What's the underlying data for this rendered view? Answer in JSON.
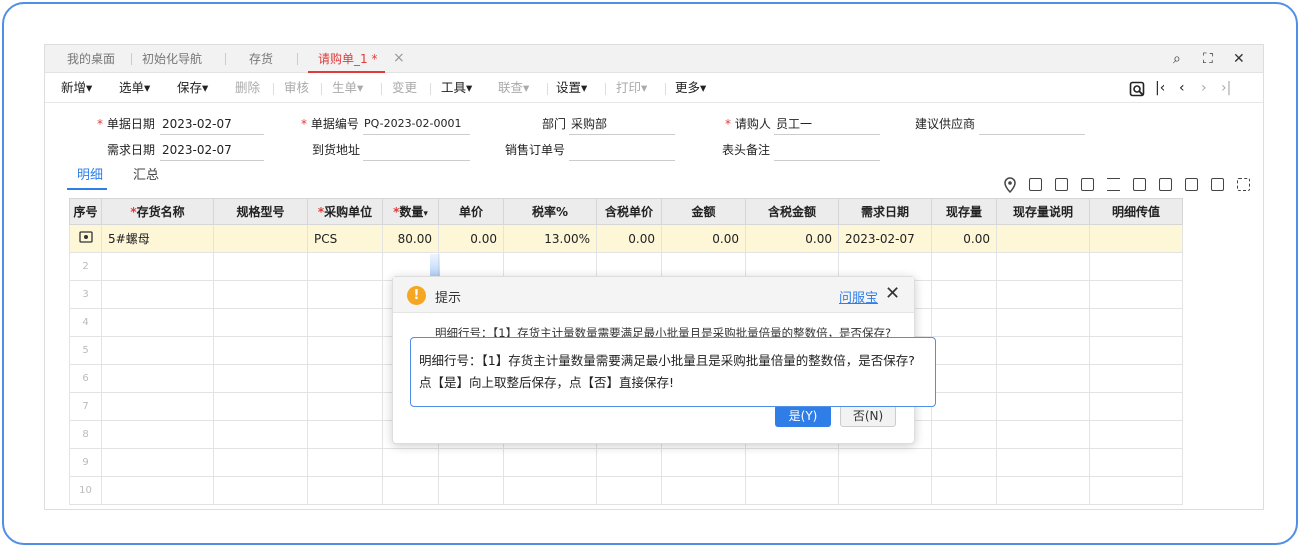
{
  "tabs": [
    {
      "label": "我的桌面"
    },
    {
      "label": "初始化导航"
    },
    {
      "label": "存货"
    },
    {
      "label": "请购单_1 *"
    }
  ],
  "tab_close": "×",
  "window_controls": {
    "search": "⌕",
    "maximize": "⛶",
    "close": "✕"
  },
  "toolbar": {
    "items": [
      "新增",
      "选单",
      "保存",
      "删除",
      "审核",
      "生单",
      "变更",
      "工具",
      "联查",
      "设置",
      "打印",
      "更多"
    ],
    "caret": "▾",
    "nav": {
      "first": "|‹",
      "prev": "‹",
      "next": "›",
      "last": "›|"
    }
  },
  "form": {
    "doc_date_label": "单据日期",
    "doc_date": "2023-02-07",
    "doc_no_label": "单据编号",
    "doc_no": "PQ-2023-02-0001",
    "dept_label": "部门",
    "dept": "采购部",
    "requester_label": "请购人",
    "requester": "员工一",
    "supplier_label": "建议供应商",
    "supplier": "",
    "need_date_label": "需求日期",
    "need_date": "2023-02-07",
    "addr_label": "到货地址",
    "addr": "",
    "so_label": "销售订单号",
    "so": "",
    "remark_label": "表头备注",
    "remark": "",
    "required_mark": "*"
  },
  "subtabs": [
    "明细",
    "汇总"
  ],
  "grid": {
    "headers": [
      "序号",
      "存货名称",
      "规格型号",
      "采购单位",
      "数量",
      "单价",
      "税率%",
      "含税单价",
      "金额",
      "含税金额",
      "需求日期",
      "现存量",
      "现存量说明",
      "明细传值"
    ],
    "row1": {
      "name": "5#螺母",
      "spec": "",
      "unit": "PCS",
      "qty": "80.00",
      "price": "0.00",
      "tax": "13.00%",
      "tax_price": "0.00",
      "amount": "0.00",
      "tax_amount": "0.00",
      "date": "2023-02-07",
      "stock": "0.00"
    },
    "row_numbers": [
      "2",
      "3",
      "4",
      "5",
      "6",
      "7",
      "8",
      "9",
      "10"
    ]
  },
  "dialog": {
    "title": "提示",
    "link": "问服宝",
    "message": "明细行号：【1】存货主计量数量需要满足最小批量且是采购批量倍量的整数倍，是否保存?",
    "yes": "是(Y)",
    "no": "否(N)"
  },
  "tooltip": {
    "line1": "明细行号：【1】存货主计量数量需要满足最小批量且是采购批量倍量的整数倍，是否保存?",
    "line2": "点【是】向上取整后保存，点【否】直接保存!"
  }
}
